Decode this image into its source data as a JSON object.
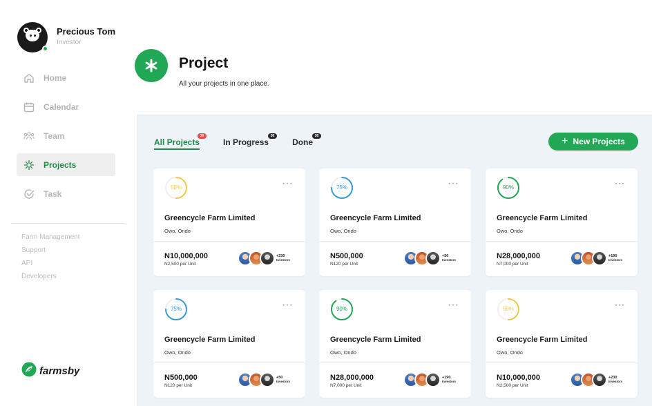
{
  "user": {
    "name": "Precious Tom",
    "role": "Investor"
  },
  "nav": [
    {
      "label": "Home",
      "icon": "home-icon",
      "active": false
    },
    {
      "label": "Calendar",
      "icon": "calendar-icon",
      "active": false
    },
    {
      "label": "Team",
      "icon": "team-icon",
      "active": false
    },
    {
      "label": "Projects",
      "icon": "projects-icon",
      "active": true
    },
    {
      "label": "Task",
      "icon": "task-icon",
      "active": false
    }
  ],
  "links": [
    "Farm Management",
    "Support",
    "API",
    "Developers"
  ],
  "brand": {
    "name": "farmsby"
  },
  "header": {
    "title": "Project",
    "subtitle": "All your projects in one place."
  },
  "tabs": [
    {
      "label": "All Projects",
      "count": "30",
      "active": true
    },
    {
      "label": "In Progress",
      "count": "30",
      "active": false
    },
    {
      "label": "Done",
      "count": "30",
      "active": false
    }
  ],
  "new_button": {
    "label": "New Projects"
  },
  "colors": {
    "accent": "#22a757",
    "yellow": "#f2c94c",
    "blue": "#3a9ad9",
    "green": "#22a757",
    "badge_red": "#ee4b4b",
    "panel_bg": "#eef3f8"
  },
  "cards": [
    {
      "progress": 50,
      "progress_label": "50%",
      "color": "yellow",
      "title": "Greencycle Farm Limited",
      "location": "Owo, Ondo",
      "price": "N10,000,000",
      "unit_price": "N2,500 per Unit",
      "investor_count": "+230",
      "investor_label": "Investors"
    },
    {
      "progress": 75,
      "progress_label": "75%",
      "color": "blue",
      "title": "Greencycle Farm Limited",
      "location": "Owo, Ondo",
      "price": "N500,000",
      "unit_price": "N120 per Unit",
      "investor_count": "+50",
      "investor_label": "Investors"
    },
    {
      "progress": 90,
      "progress_label": "90%",
      "color": "green",
      "title": "Greencycle Farm Limited",
      "location": "Owo, Ondo",
      "price": "N28,000,000",
      "unit_price": "N7,000 per Unit",
      "investor_count": "+190",
      "investor_label": "Investors"
    },
    {
      "progress": 75,
      "progress_label": "75%",
      "color": "blue",
      "title": "Greencycle Farm Limited",
      "location": "Owo, Ondo",
      "price": "N500,000",
      "unit_price": "N120 per Unit",
      "investor_count": "+50",
      "investor_label": "Investors"
    },
    {
      "progress": 90,
      "progress_label": "90%",
      "color": "green",
      "title": "Greencycle Farm Limited",
      "location": "Owo, Ondo",
      "price": "N28,000,000",
      "unit_price": "N7,000 per Unit",
      "investor_count": "+190",
      "investor_label": "Investors"
    },
    {
      "progress": 50,
      "progress_label": "50%",
      "color": "yellow",
      "title": "Greencycle Farm Limited",
      "location": "Owo, Ondo",
      "price": "N10,000,000",
      "unit_price": "N2,500 per Unit",
      "investor_count": "+230",
      "investor_label": "Investors"
    }
  ]
}
